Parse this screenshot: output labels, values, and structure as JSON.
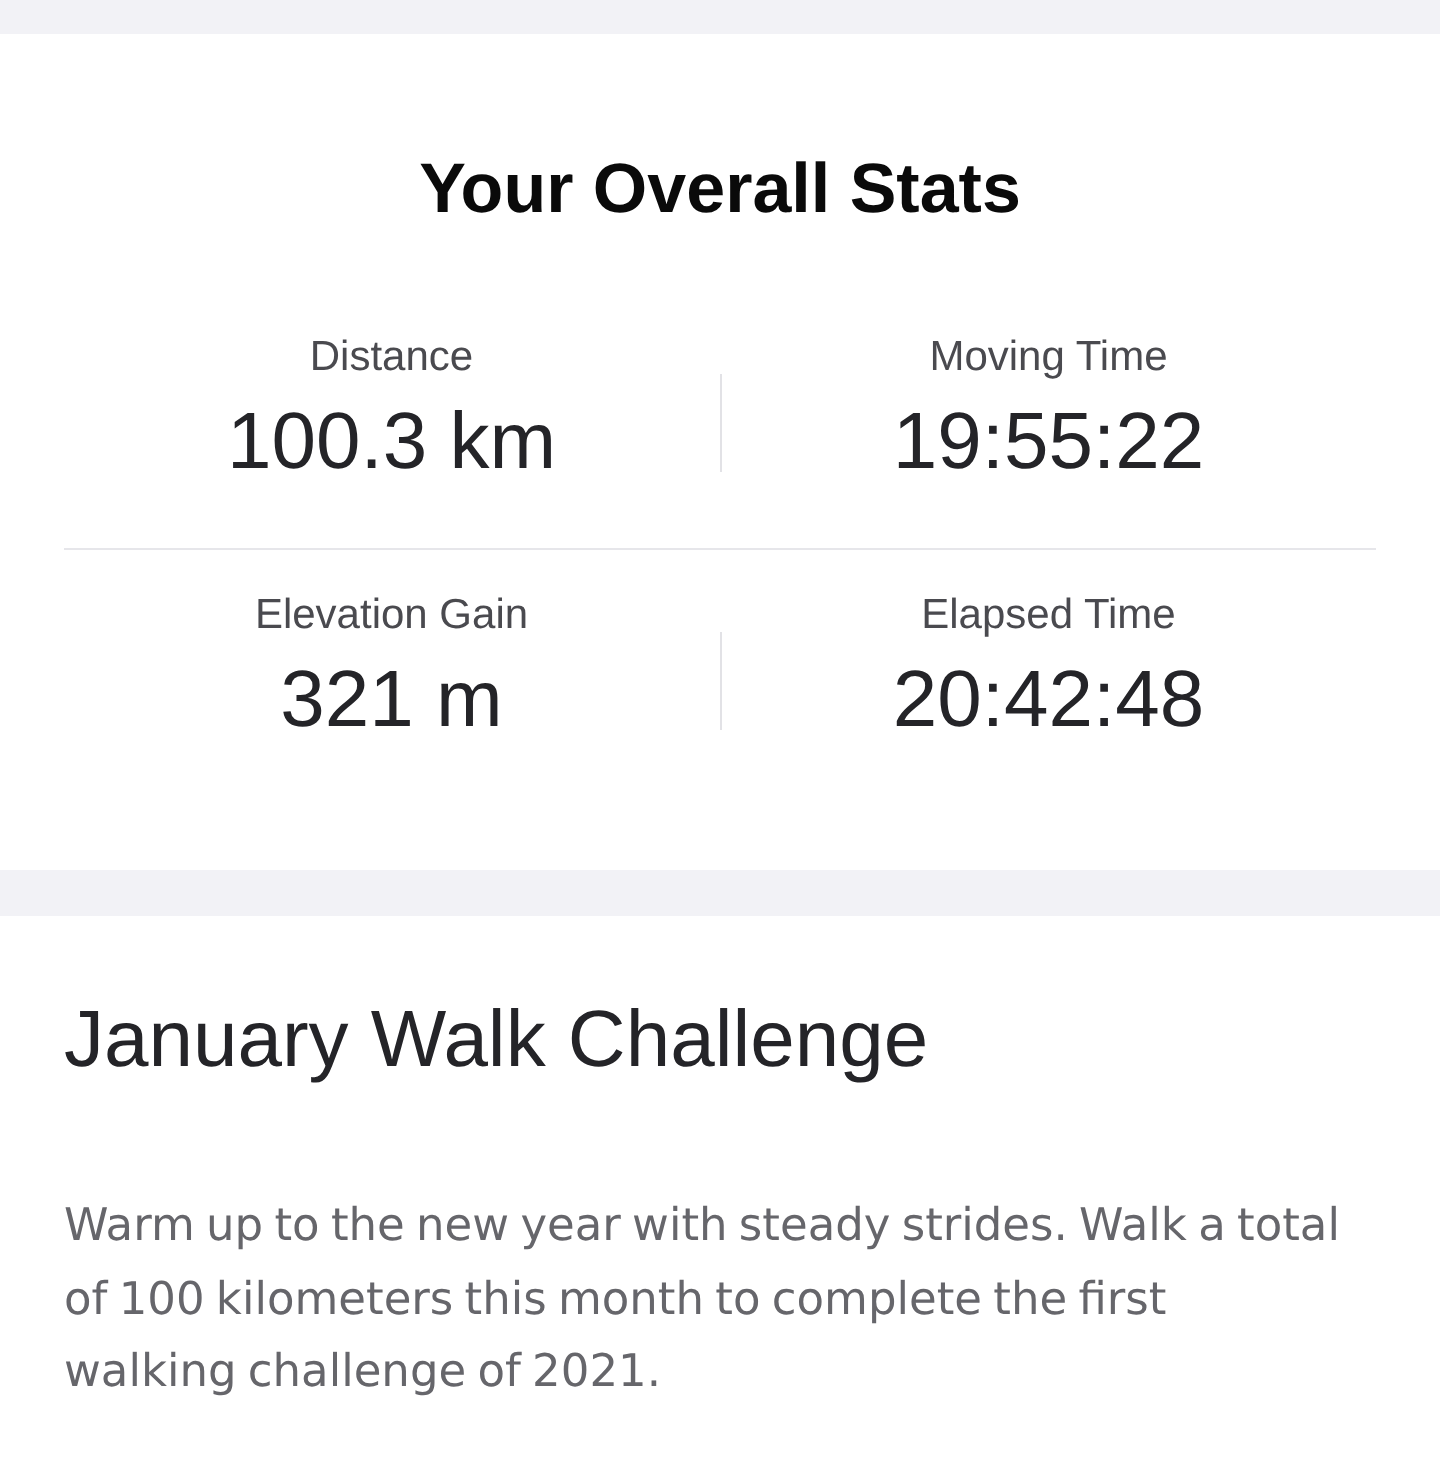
{
  "overall_stats": {
    "title": "Your Overall Stats",
    "stats": [
      {
        "label": "Distance",
        "value": "100.3 km"
      },
      {
        "label": "Moving Time",
        "value": "19:55:22"
      },
      {
        "label": "Elevation Gain",
        "value": "321 m"
      },
      {
        "label": "Elapsed Time",
        "value": "20:42:48"
      }
    ]
  },
  "challenge": {
    "title": "January Walk Challenge",
    "description": "Warm up to the new year with steady strides. Walk a total of 100 kilometers this month to complete the first walking challenge of 2021."
  }
}
